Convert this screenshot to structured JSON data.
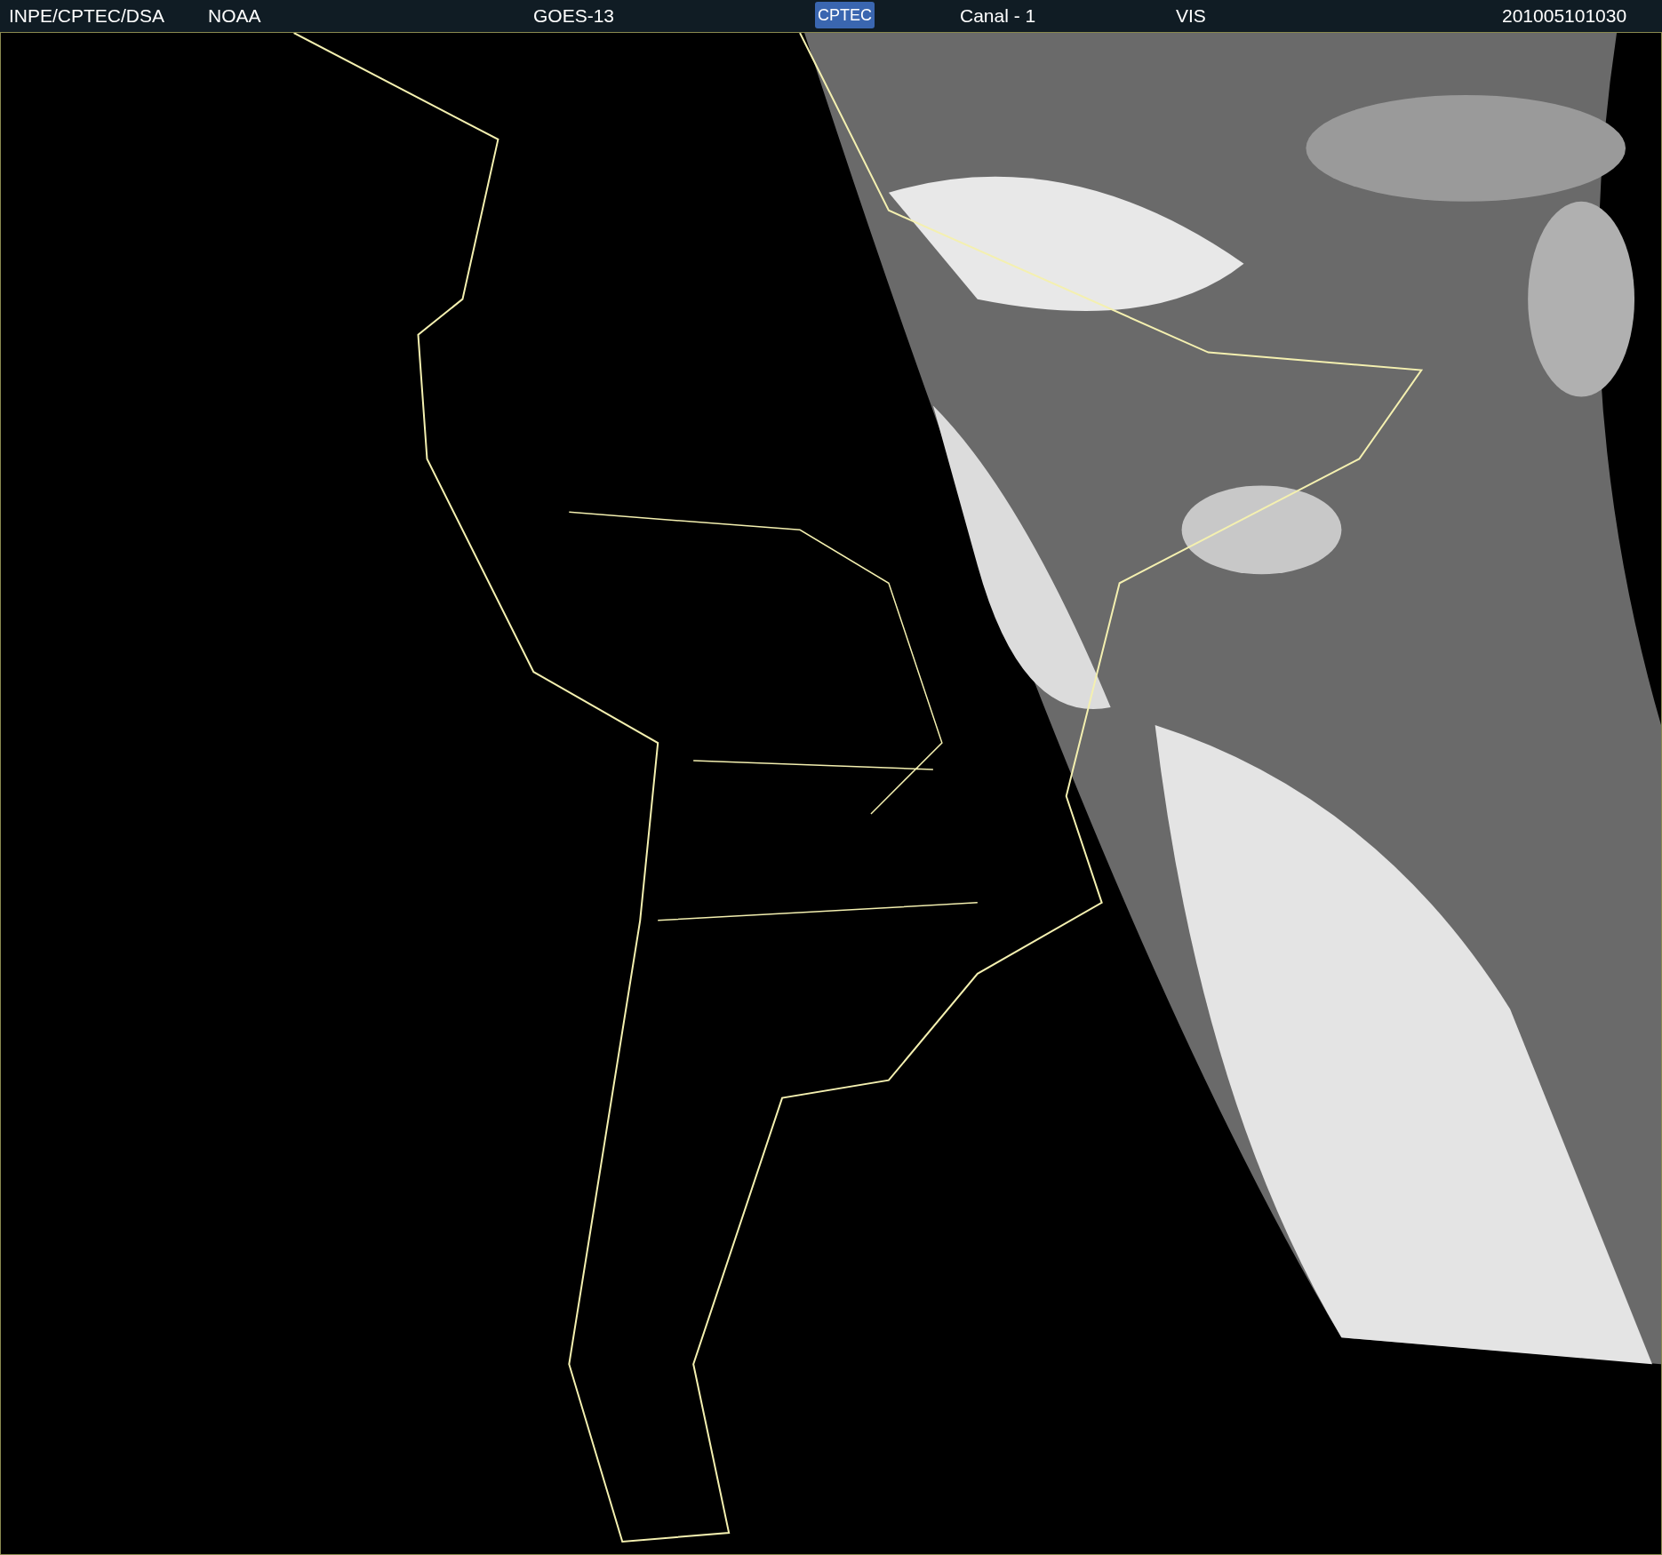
{
  "header": {
    "items": [
      {
        "kind": "text",
        "text": "INPE/CPTEC/DSA"
      },
      {
        "kind": "text",
        "text": "NOAA"
      },
      {
        "kind": "text",
        "text": "GOES-13"
      },
      {
        "kind": "logo",
        "text": "CPTEC"
      },
      {
        "kind": "text",
        "text": "Canal - 1"
      },
      {
        "kind": "text",
        "text": "VIS"
      },
      {
        "kind": "text",
        "text": "201005101030"
      }
    ]
  }
}
